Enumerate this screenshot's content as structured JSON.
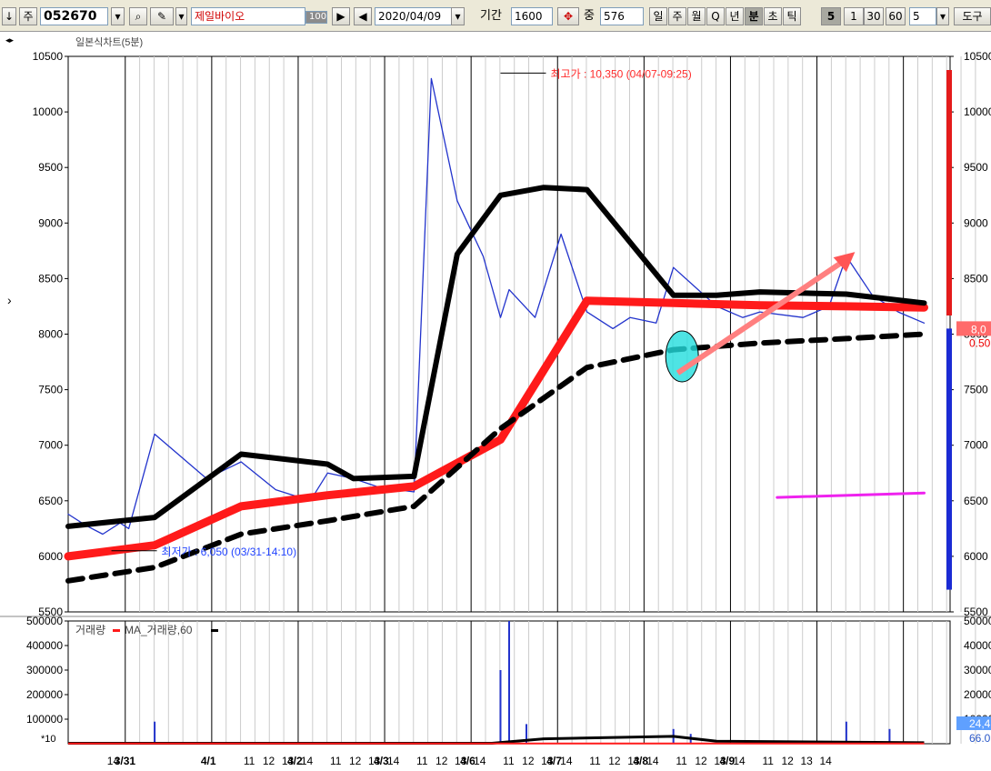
{
  "toolbar": {
    "arrow_label": "↓",
    "type_label": "주",
    "stock_code": "052670",
    "stock_name": "제일바이오",
    "count_badge": "100",
    "date": "2020/04/09",
    "period_label": "기간",
    "period_value": "1600",
    "jung_label": "중",
    "jung_value": "576",
    "interval_buttons": [
      "일",
      "주",
      "월",
      "Q",
      "년",
      "분",
      "초",
      "틱"
    ],
    "active_interval": "분",
    "minute_buttons": [
      "5",
      "1",
      "30",
      "60"
    ],
    "active_minute": "5",
    "minute_select": "5",
    "right_label": "도구"
  },
  "chart_data": {
    "type": "line",
    "title": "일본식차트(5분)",
    "price_axis": {
      "ylim": [
        5500,
        10500
      ],
      "ticks": [
        5500,
        6000,
        6500,
        7000,
        7500,
        8000,
        8500,
        9000,
        9500,
        10000,
        10500
      ]
    },
    "volume_axis": {
      "ylim": [
        0,
        500000
      ],
      "ticks": [
        100000,
        200000,
        300000,
        400000,
        500000
      ],
      "multiplier_label": "*10"
    },
    "x_tick_labels": [
      {
        "d": "3/31",
        "bold": true
      },
      {
        "d": "14"
      },
      {
        "d": "4/1",
        "bold": true
      },
      {
        "d": "11"
      },
      {
        "d": "12"
      },
      {
        "d": "13"
      },
      {
        "d": "14"
      },
      {
        "d": "4/2",
        "bold": true
      },
      {
        "d": "11"
      },
      {
        "d": "12"
      },
      {
        "d": "13"
      },
      {
        "d": "14"
      },
      {
        "d": "4/3",
        "bold": true
      },
      {
        "d": "11"
      },
      {
        "d": "12"
      },
      {
        "d": "13"
      },
      {
        "d": "14"
      },
      {
        "d": "4/6",
        "bold": true
      },
      {
        "d": "11"
      },
      {
        "d": "12"
      },
      {
        "d": "13"
      },
      {
        "d": "14"
      },
      {
        "d": "4/7",
        "bold": true
      },
      {
        "d": "11"
      },
      {
        "d": "12"
      },
      {
        "d": "13"
      },
      {
        "d": "14"
      },
      {
        "d": "4/8",
        "bold": true
      },
      {
        "d": "11"
      },
      {
        "d": "12"
      },
      {
        "d": "13"
      },
      {
        "d": "14"
      },
      {
        "d": "4/9",
        "bold": true
      },
      {
        "d": "11"
      },
      {
        "d": "12"
      },
      {
        "d": "13"
      },
      {
        "d": "14"
      }
    ],
    "high_annotation": {
      "text": "최고가 : 10,350 (04/07-09:25)",
      "value": 10350
    },
    "low_annotation": {
      "text": "최저가 : 6,050 (03/31-14:10)",
      "value": 6050
    },
    "current_price_label": "8,0",
    "right_pct_label": "0.50",
    "volume_legend": [
      "거래량",
      "MA_거래량,60"
    ],
    "volume_badges": [
      "24,4",
      "66.0"
    ],
    "colors": {
      "price": "#2233cc",
      "ma_red": "#ff1a1a",
      "ma_black": "#000000",
      "volume": "#2233cc",
      "high_text": "#ff2a2a",
      "low_text": "#2244ff"
    },
    "series": [
      {
        "name": "price",
        "x": [
          0,
          0.2,
          0.4,
          0.6,
          0.7,
          1,
          1.3,
          1.6,
          2,
          2.4,
          2.8,
          3,
          3.3,
          3.6,
          4,
          4.2,
          4.5,
          4.8,
          5,
          5.1,
          5.4,
          5.7,
          6,
          6.3,
          6.5,
          6.8,
          7,
          7.5,
          7.8,
          8,
          8.5,
          8.8,
          9,
          9.3,
          9.6,
          9.9
        ],
        "values": [
          6380,
          6280,
          6200,
          6300,
          6250,
          7100,
          6900,
          6700,
          6850,
          6600,
          6500,
          6750,
          6700,
          6620,
          6580,
          10300,
          9200,
          8700,
          8150,
          8400,
          8150,
          8900,
          8200,
          8050,
          8150,
          8100,
          8600,
          8250,
          8150,
          8200,
          8150,
          8250,
          8700,
          8350,
          8200,
          8100
        ]
      },
      {
        "name": "ma_red",
        "x": [
          0,
          1,
          2,
          3,
          4,
          5,
          6,
          7,
          8,
          9,
          9.9
        ],
        "values": [
          6000,
          6100,
          6450,
          6550,
          6630,
          7050,
          8300,
          8280,
          8260,
          8250,
          8240
        ]
      },
      {
        "name": "ma_black",
        "x": [
          0,
          1,
          2,
          3,
          3.3,
          4,
          4.5,
          5,
          5.5,
          6,
          7,
          7.5,
          8,
          9,
          9.9
        ],
        "values": [
          6270,
          6350,
          6920,
          6830,
          6700,
          6720,
          8720,
          9250,
          9320,
          9300,
          8350,
          8350,
          8380,
          8360,
          8280
        ]
      },
      {
        "name": "ma_dashed",
        "x": [
          0,
          1,
          2,
          3,
          4,
          5,
          6,
          7,
          8,
          9,
          9.9
        ],
        "values": [
          5780,
          5900,
          6200,
          6320,
          6450,
          7150,
          7700,
          7860,
          7920,
          7960,
          8000
        ]
      },
      {
        "name": "magenta",
        "x": [
          8.2,
          9.9
        ],
        "values": [
          6530,
          6570
        ]
      }
    ],
    "volume": {
      "x": [
        1,
        5,
        5.1,
        5.3,
        7,
        7.2,
        9,
        9.5
      ],
      "values": [
        90000,
        300000,
        500000,
        80000,
        60000,
        40000,
        90000,
        60000
      ]
    }
  }
}
